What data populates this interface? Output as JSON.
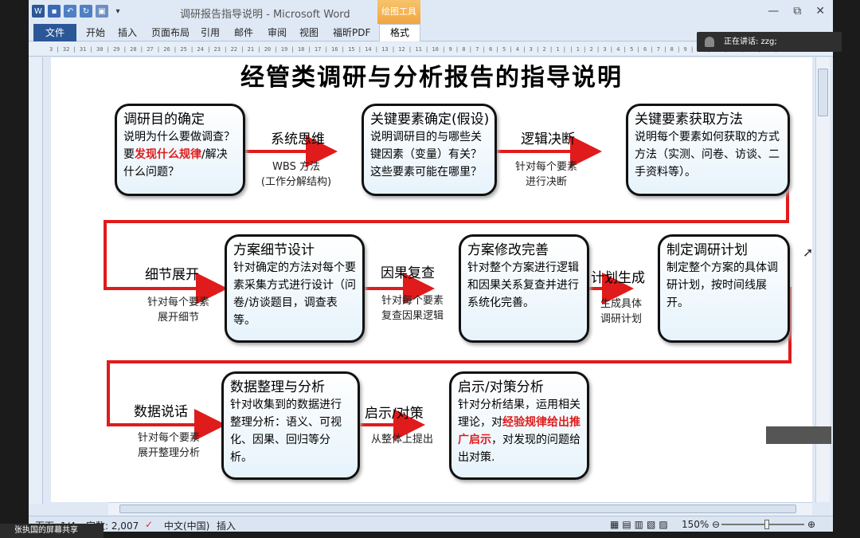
{
  "window": {
    "title": "调研报告指导说明 - Microsoft Word",
    "context_tab_group": "绘图工具",
    "controls": {
      "minimize": "—",
      "restore": "⧉",
      "close": "✕"
    }
  },
  "ribbon": {
    "file_tab": "文件",
    "tabs": [
      "开始",
      "插入",
      "页面布局",
      "引用",
      "邮件",
      "审阅",
      "视图",
      "福昕PDF"
    ],
    "context_tab": "格式"
  },
  "ruler": {
    "marks": "3 | 32 | 31 | 30 | 29 | 28 | 27 | 26 | 25 | 24 | 23 | 22 | 21 | 20 | 19 | 18 | 17 | 16 | 15 | 14 | 13 | 12 | 11 | 10 | 9 | 8 | 7 | 6 | 5 | 4 | 3 | 2 | 1 |   | 1 | 2 | 3 | 4 | 5 | 6 | 7 | 8 | 9 | 10 | 11 | 12 | 13 | 14 | 15"
  },
  "document": {
    "title": "经管类调研与分析报告的指导说明",
    "boxes": [
      {
        "title": "调研目的确定",
        "text_before": "说明为什么要做调查？要",
        "highlight": "发现什么规律",
        "text_after": "/解决什么问题？"
      },
      {
        "title": "关键要素确定(假设)",
        "text_before": "说明调研目的与哪些关键因素（变量）有关？这些要素可能在哪里？",
        "highlight": "",
        "text_after": ""
      },
      {
        "title": "关键要素获取方法",
        "text_before": "说明每个要素如何获取的方式方法（实测、问卷、访谈、二手资料等）。",
        "highlight": "",
        "text_after": ""
      },
      {
        "title": "方案细节设计",
        "text_before": "针对确定的方法对每个要素采集方式进行设计（问卷/访谈题目，调查表等。",
        "highlight": "",
        "text_after": ""
      },
      {
        "title": "方案修改完善",
        "text_before": "针对整个方案进行逻辑和因果关系复查并进行系统化完善。",
        "highlight": "",
        "text_after": ""
      },
      {
        "title": "制定调研计划",
        "text_before": "制定整个方案的具体调研计划，按时间线展开。",
        "highlight": "",
        "text_after": ""
      },
      {
        "title": "数据整理与分析",
        "text_before": "针对收集到的数据进行整理分析：语义、可视化、因果、回归等分析。",
        "highlight": "",
        "text_after": ""
      },
      {
        "title": "启示/对策分析",
        "text_before": "针对分析结果，运用相关理论，对",
        "highlight": "经验规律给出推广启示",
        "text_after": "，对发现的问题给出对策."
      }
    ],
    "connectors": [
      {
        "label": "系统思维",
        "sub": "WBS 方法\n(工作分解结构)"
      },
      {
        "label": "逻辑决断",
        "sub": "针对每个要素\n进行决断"
      },
      {
        "label": "细节展开",
        "sub": "针对每个要素\n展开细节"
      },
      {
        "label": "因果复查",
        "sub": "针对每个要素\n复查因果逻辑"
      },
      {
        "label": "计划生成",
        "sub": "生成具体\n调研计划"
      },
      {
        "label": "数据说话",
        "sub": "针对每个要素\n展开整理分析"
      },
      {
        "label": "启示/对策",
        "sub": "从整体上提出"
      }
    ],
    "colors": {
      "arrow": "#e01b1b",
      "highlight": "#e01b1b",
      "box_fill": "#e6f3fb"
    }
  },
  "statusbar": {
    "page": "页面: 1/4",
    "words": "字数: 2,007",
    "language": "中文(中国)",
    "mode": "插入",
    "zoom": "150%"
  },
  "overlay": {
    "speaking": "正在讲话: zzg;",
    "share": "张执国的屏幕共享"
  }
}
